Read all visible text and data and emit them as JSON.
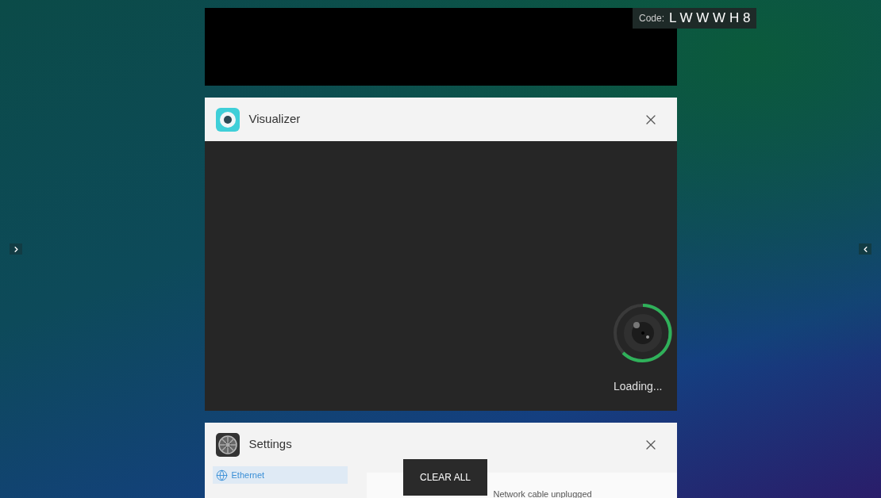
{
  "code_badge": {
    "label": "Code:",
    "value": "L W W W H 8"
  },
  "cards": [
    {
      "kind": "blank"
    },
    {
      "kind": "loading",
      "title": "Visualizer",
      "status": "Loading..."
    },
    {
      "kind": "settings",
      "title": "Settings",
      "menu": [
        {
          "label": "Ethernet",
          "selected": true
        }
      ],
      "message": "Network cable unplugged"
    }
  ],
  "clear_button": "CLEAR ALL"
}
